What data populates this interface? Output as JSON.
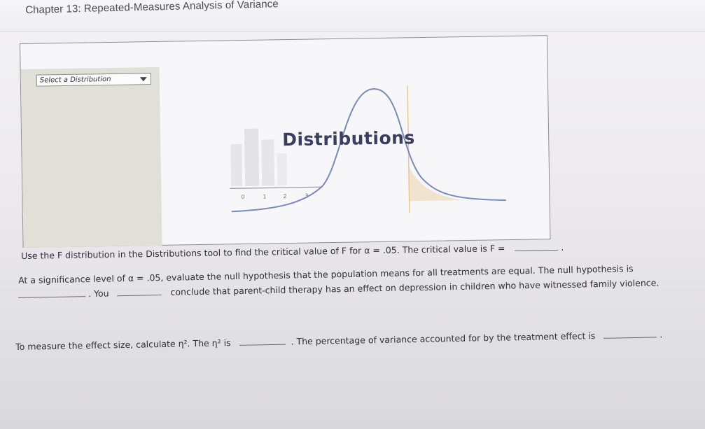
{
  "header": {
    "chapter_title": "Chapter 13: Repeated-Measures Analysis of Variance"
  },
  "tool": {
    "select_label": "Select a Distribution",
    "graphic_title": "Distributions",
    "axis_ticks": [
      "0",
      "1",
      "2",
      "3"
    ]
  },
  "questions": {
    "q1_text": "Use the F distribution in the Distributions tool to find the critical value of F for α = .05. The critical value is F =",
    "q1_end": ".",
    "q2_line1": "At a significance level of α = .05, evaluate the null hypothesis that the population means for all treatments are equal. The null hypothesis is",
    "q2_you": ". You",
    "q2_line2": "conclude that parent-child therapy has an effect on depression in children who have witnessed family violence.",
    "q3_text": "To measure the effect size, calculate η². The η² is",
    "q3_mid": ". The percentage of variance accounted for by the treatment effect is",
    "q3_end": "."
  }
}
